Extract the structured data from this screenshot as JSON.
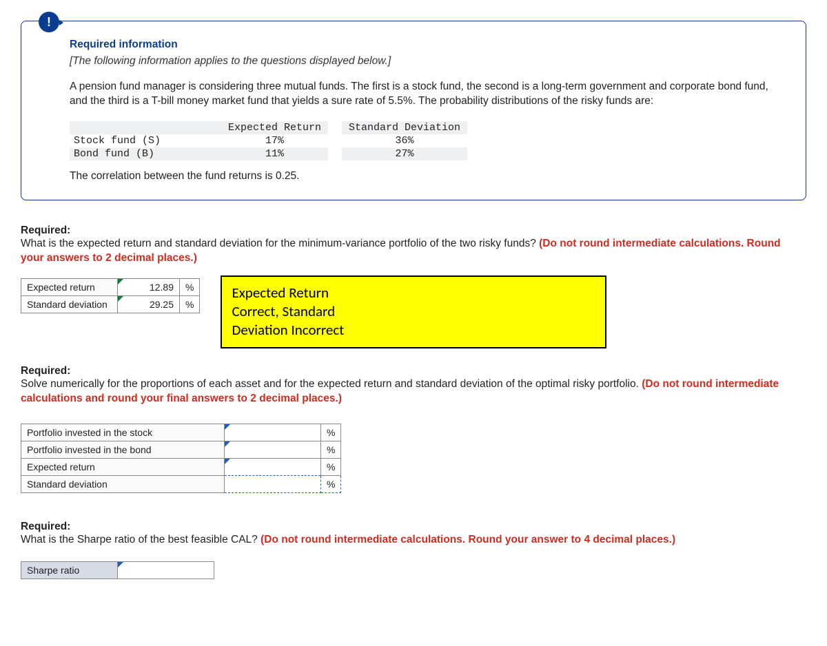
{
  "info_badge_glyph": "!",
  "info_title": "Required information",
  "applies_text": "[The following information applies to the questions displayed below.]",
  "problem_text": "A pension fund manager is considering three mutual funds. The first is a stock fund, the second is a long-term government and corporate bond fund, and the third is a T-bill money market fund that yields a sure rate of 5.5%. The probability distributions of the risky funds are:",
  "dist": {
    "head_er": "Expected Return",
    "head_sd": "Standard Deviation",
    "rows": [
      {
        "name": "Stock fund (S)",
        "er": "17%",
        "sd": "36%"
      },
      {
        "name": "Bond fund (B)",
        "er": "11%",
        "sd": "27%"
      }
    ]
  },
  "correlation_text": "The correlation between the fund returns is 0.25.",
  "q1": {
    "label": "Required:",
    "text_plain": "What is the expected return and standard deviation for the minimum-variance portfolio of the two risky funds? ",
    "text_red": "(Do not round intermediate calculations. Round your answers to 2 decimal places.)",
    "r1_label": "Expected return",
    "r1_value": "12.89",
    "r2_label": "Standard deviation",
    "r2_value": "29.25",
    "unit": "%"
  },
  "callout_text": "Expected Return Correct, Standard Deviation Incorrect",
  "q2": {
    "label": "Required:",
    "text_plain": "Solve numerically for the proportions of each asset and for the expected return and standard deviation of the optimal risky portfolio. ",
    "text_red": "(Do not round intermediate calculations and round your final answers to 2 decimal places.)",
    "rows": [
      {
        "label": "Portfolio invested in the stock",
        "value": "",
        "unit": "%"
      },
      {
        "label": "Portfolio invested in the bond",
        "value": "",
        "unit": "%"
      },
      {
        "label": "Expected return",
        "value": "",
        "unit": "%"
      },
      {
        "label": "Standard deviation",
        "value": "",
        "unit": "%"
      }
    ]
  },
  "q3": {
    "label": "Required:",
    "text_plain": "What is the Sharpe ratio of the best feasible CAL? ",
    "text_red": "(Do not round intermediate calculations. Round your answer to 4 decimal places.)",
    "r1_label": "Sharpe ratio",
    "r1_value": ""
  }
}
